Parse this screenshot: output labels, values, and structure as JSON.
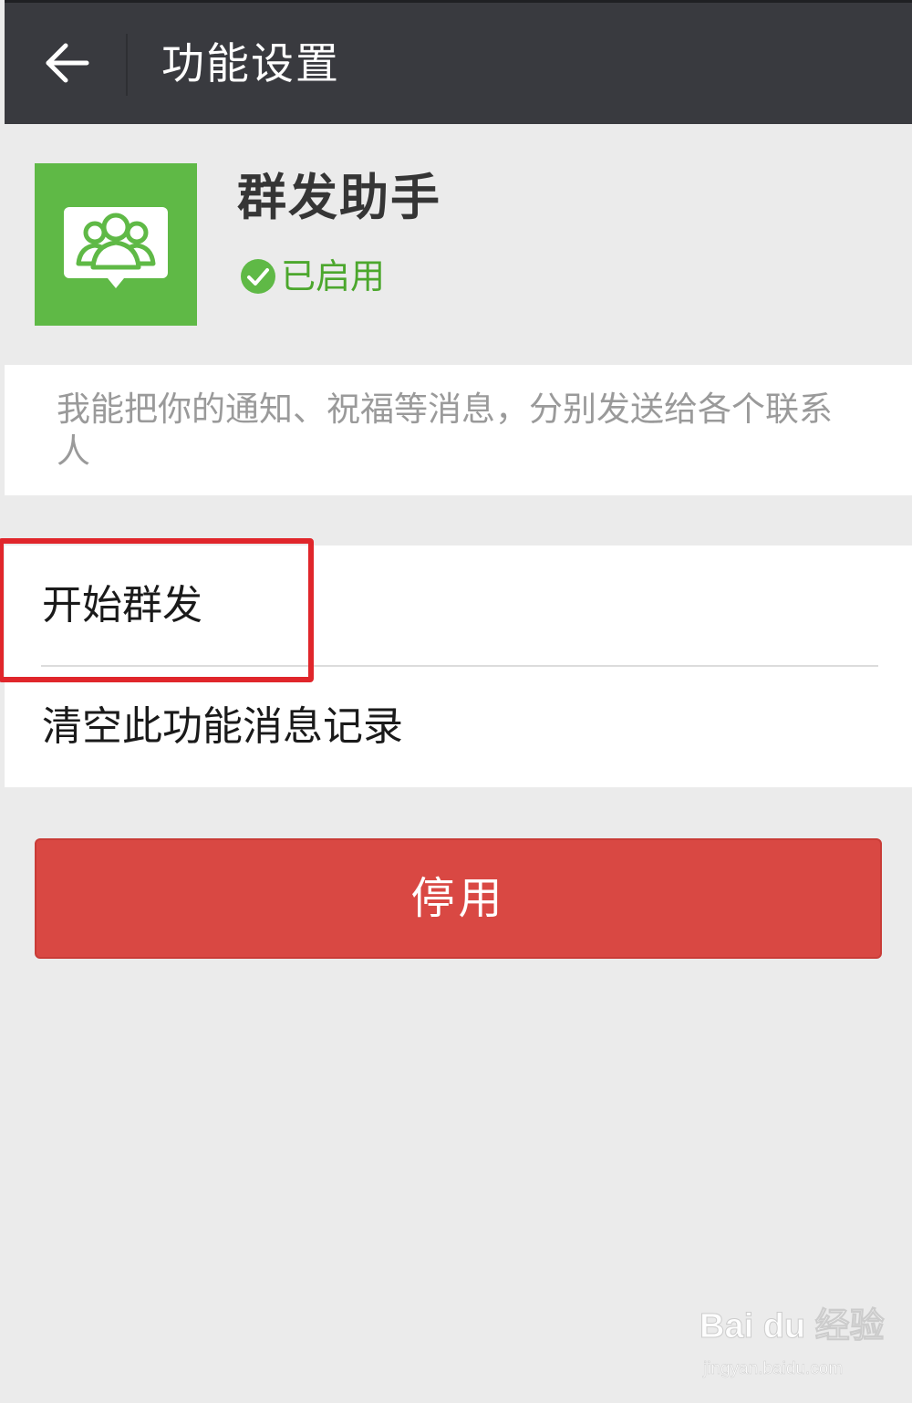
{
  "appbar": {
    "title": "功能设置",
    "back_icon": "arrow-left-icon"
  },
  "plugin": {
    "name": "群发助手",
    "icon": "group-chat-icon",
    "status": "已启用",
    "status_icon": "check-circle-icon",
    "status_color": "#4ca72d",
    "icon_bg_color": "#5fb946"
  },
  "description": "我能把你的通知、祝福等消息，分别发送给各个联系人",
  "menu": {
    "items": [
      {
        "label": "开始群发"
      },
      {
        "label": "清空此功能消息记录"
      }
    ]
  },
  "actions": {
    "disable_label": "停用",
    "disable_color": "#d94843"
  },
  "annotation": {
    "highlight_color": "#e0262b"
  },
  "watermark": {
    "brand": "Bai du 经验",
    "url": "jingyan.baidu.com"
  }
}
